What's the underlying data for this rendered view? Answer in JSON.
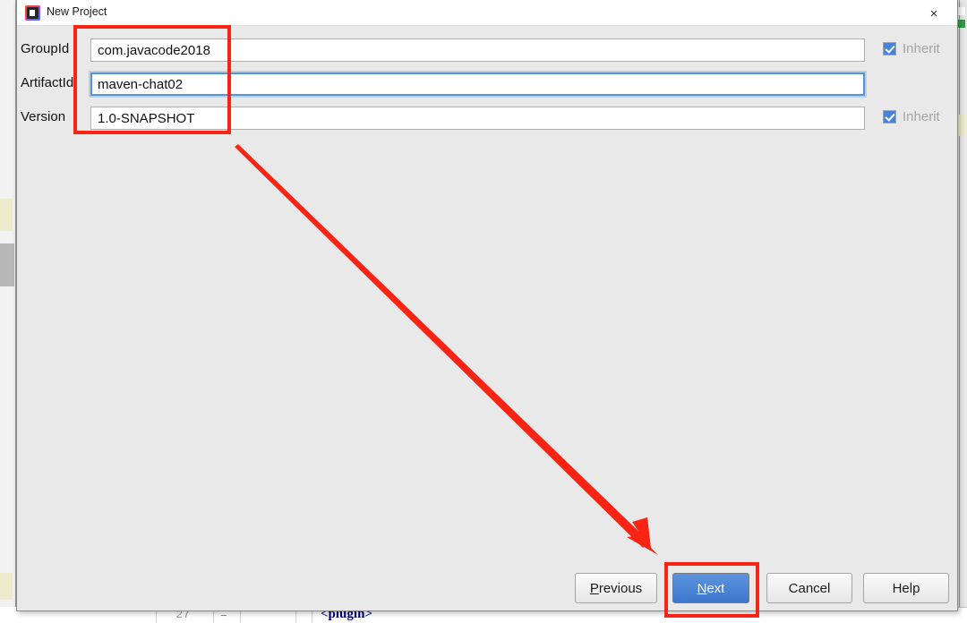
{
  "window": {
    "title": "New Project",
    "icon": "intellij-idea-icon",
    "close_label": "×"
  },
  "form": {
    "rows": [
      {
        "label": "GroupId",
        "value": "com.javacode2018",
        "placeholder": "",
        "focused": false,
        "inherit_label": "Inherit",
        "inherit_checked": true
      },
      {
        "label": "ArtifactId",
        "value": "maven-chat02",
        "placeholder": "",
        "focused": true,
        "inherit_label": "",
        "inherit_checked": false
      },
      {
        "label": "Version",
        "value": "1.0-SNAPSHOT",
        "placeholder": "",
        "focused": false,
        "inherit_label": "Inherit",
        "inherit_checked": true
      }
    ]
  },
  "buttons": {
    "previous": {
      "prefix": "",
      "mnemonic": "P",
      "suffix": "revious"
    },
    "next": {
      "prefix": "",
      "mnemonic": "N",
      "suffix": "ext"
    },
    "cancel": {
      "label": "Cancel"
    },
    "help": {
      "label": "Help"
    }
  },
  "annotations": {
    "fields_highlight": "red-rectangle-around-coordinate-fields",
    "next_highlight": "red-rectangle-around-next-button",
    "arrow": "red-arrow-pointing-to-next-button",
    "color": "#fa2414"
  },
  "background_editor": {
    "line_number": "27",
    "fold_marker": "−",
    "code": "<plugin>"
  },
  "colors": {
    "dialog_background": "#e9e9e9",
    "title_bar": "#ffffff",
    "primary_button": "#4a83d4",
    "checkbox": "#4a83d4",
    "focus_border": "#5596d8",
    "annotation_red": "#fa2414",
    "inherit_label": "#a3a3a3",
    "code_blue": "#000080"
  }
}
